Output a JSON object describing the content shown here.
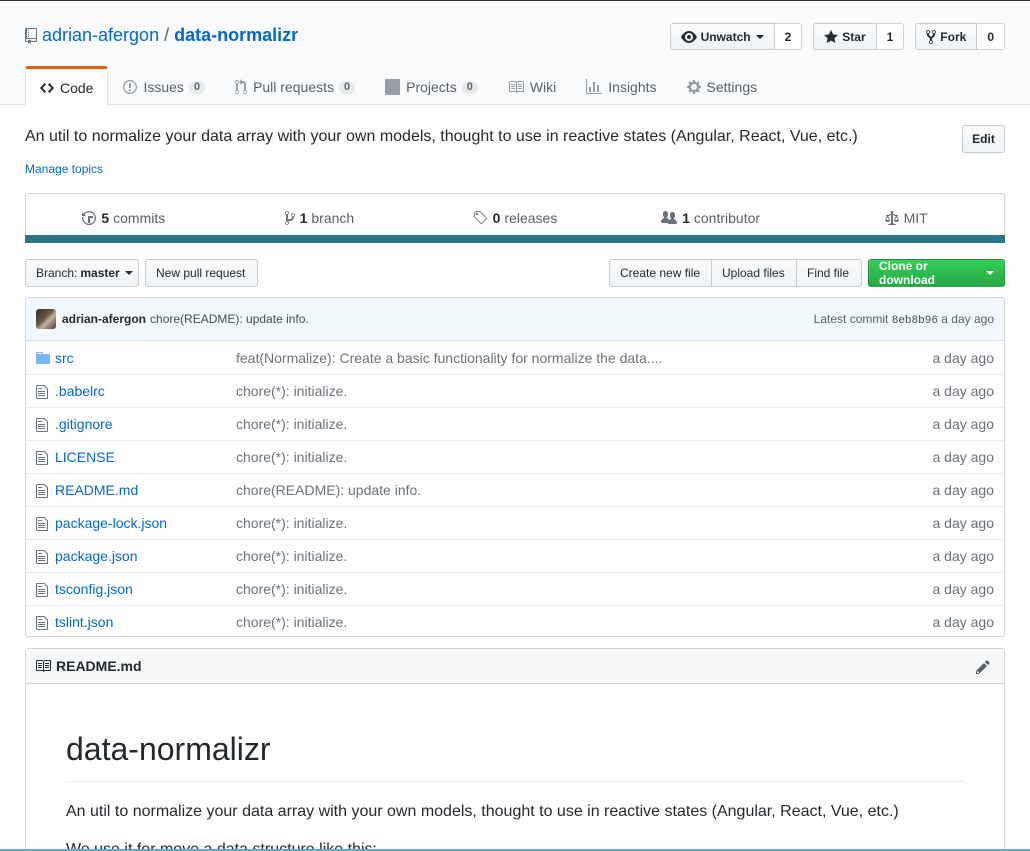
{
  "repo": {
    "owner": "adrian-afergon",
    "separator": "/",
    "name": "data-normalizr"
  },
  "actions": {
    "watch_label": "Unwatch",
    "watch_count": "2",
    "star_label": "Star",
    "star_count": "1",
    "fork_label": "Fork",
    "fork_count": "0"
  },
  "tabs": [
    {
      "label": "Code",
      "count": null,
      "icon": "code-icon"
    },
    {
      "label": "Issues",
      "count": "0",
      "icon": "issue-opened-icon"
    },
    {
      "label": "Pull requests",
      "count": "0",
      "icon": "git-pull-request-icon"
    },
    {
      "label": "Projects",
      "count": "0",
      "icon": "project-icon"
    },
    {
      "label": "Wiki",
      "count": null,
      "icon": "book-icon"
    },
    {
      "label": "Insights",
      "count": null,
      "icon": "graph-icon"
    },
    {
      "label": "Settings",
      "count": null,
      "icon": "gear-icon"
    }
  ],
  "description": "An util to normalize your data array with your own models, thought to use in reactive states (Angular, React, Vue, etc.)",
  "edit_label": "Edit",
  "manage_topics": "Manage topics",
  "summary": {
    "commits_num": "5",
    "commits_label": "commits",
    "branch_num": "1",
    "branch_label": "branch",
    "releases_num": "0",
    "releases_label": "releases",
    "contributors_num": "1",
    "contributors_label": "contributor",
    "license": "MIT"
  },
  "language_color": "#2b7489",
  "file_nav": {
    "branch_prefix": "Branch:",
    "branch_name": "master",
    "new_pr": "New pull request",
    "create_file": "Create new file",
    "upload_files": "Upload files",
    "find_file": "Find file",
    "clone": "Clone or download"
  },
  "latest_commit": {
    "author": "adrian-afergon",
    "message": "chore(README): update info.",
    "prefix": "Latest commit",
    "sha": "8eb8b96",
    "age": "a day ago"
  },
  "files": [
    {
      "name": "src",
      "type": "dir",
      "message": "feat(Normalize): Create a basic functionality for normalize the data....",
      "age": "a day ago"
    },
    {
      "name": ".babelrc",
      "type": "file",
      "message": "chore(*): initialize.",
      "age": "a day ago"
    },
    {
      "name": ".gitignore",
      "type": "file",
      "message": "chore(*): initialize.",
      "age": "a day ago"
    },
    {
      "name": "LICENSE",
      "type": "file",
      "message": "chore(*): initialize.",
      "age": "a day ago"
    },
    {
      "name": "README.md",
      "type": "file",
      "message": "chore(README): update info.",
      "age": "a day ago"
    },
    {
      "name": "package-lock.json",
      "type": "file",
      "message": "chore(*): initialize.",
      "age": "a day ago"
    },
    {
      "name": "package.json",
      "type": "file",
      "message": "chore(*): initialize.",
      "age": "a day ago"
    },
    {
      "name": "tsconfig.json",
      "type": "file",
      "message": "chore(*): initialize.",
      "age": "a day ago"
    },
    {
      "name": "tslint.json",
      "type": "file",
      "message": "chore(*): initialize.",
      "age": "a day ago"
    }
  ],
  "readme": {
    "filename": "README.md",
    "heading": "data-normalizr",
    "paragraph1": "An util to normalize your data array with your own models, thought to use in reactive states (Angular, React, Vue, etc.)",
    "paragraph2": "We use it for move a data structure like this:"
  }
}
